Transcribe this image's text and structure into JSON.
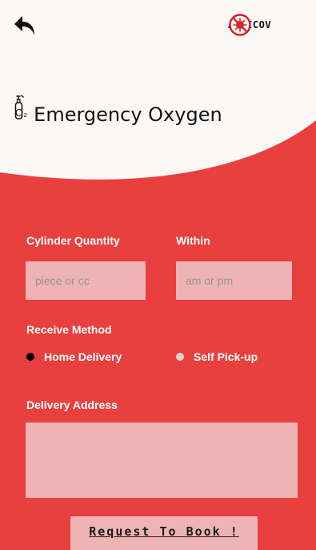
{
  "header": {
    "back_icon": "back-arrow-icon",
    "brand_icon": "virus-prohibited-icon",
    "brand_name": "ANTICOV",
    "title_icon": "oxygen-cylinder-icon",
    "title_icon_label": "O₂",
    "title": "Emergency Oxygen"
  },
  "form": {
    "quantity_label": "Cylinder Quantity",
    "quantity_placeholder": "piece or cc",
    "within_label": "Within",
    "within_placeholder": "am or pm",
    "receive_label": "Receive Method",
    "options": [
      {
        "label": "Home Delivery",
        "selected": true
      },
      {
        "label": "Self Pick-up",
        "selected": false
      }
    ],
    "address_label": "Delivery Address",
    "submit_label": "Request To Book !"
  },
  "colors": {
    "primary": "#e8403f",
    "field_bg": "#eeb4b5",
    "header_bg": "#fbf8f6"
  }
}
